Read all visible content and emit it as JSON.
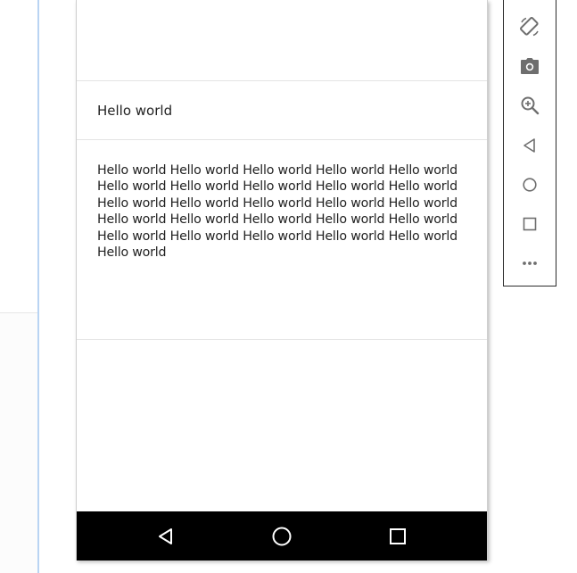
{
  "app": {
    "list": {
      "single_line_item": "Hello world",
      "multi_line_item": "Hello world Hello world Hello world Hello world Hello world Hello world Hello world Hello world Hello world Hello world Hello world Hello world Hello world Hello world Hello world Hello world Hello world Hello world Hello world Hello world Hello world Hello world Hello world Hello world Hello world Hello world"
    }
  },
  "device_nav": {
    "buttons": [
      {
        "name": "back",
        "icon": "triangle-back-icon"
      },
      {
        "name": "home",
        "icon": "circle-home-icon"
      },
      {
        "name": "overview",
        "icon": "square-overview-icon"
      }
    ]
  },
  "emulator_toolbar": {
    "tools": [
      {
        "name": "rotate",
        "icon": "rotate-icon"
      },
      {
        "name": "screenshot",
        "icon": "camera-icon"
      },
      {
        "name": "zoom",
        "icon": "zoom-in-icon"
      },
      {
        "name": "back",
        "icon": "back-icon"
      },
      {
        "name": "home",
        "icon": "home-icon"
      },
      {
        "name": "overview",
        "icon": "overview-icon"
      },
      {
        "name": "more",
        "icon": "more-icon"
      }
    ]
  },
  "colors": {
    "nav_bar": "#000000",
    "accent_line": "#b9d4f3",
    "icon_gray": "#6e6e6e"
  }
}
